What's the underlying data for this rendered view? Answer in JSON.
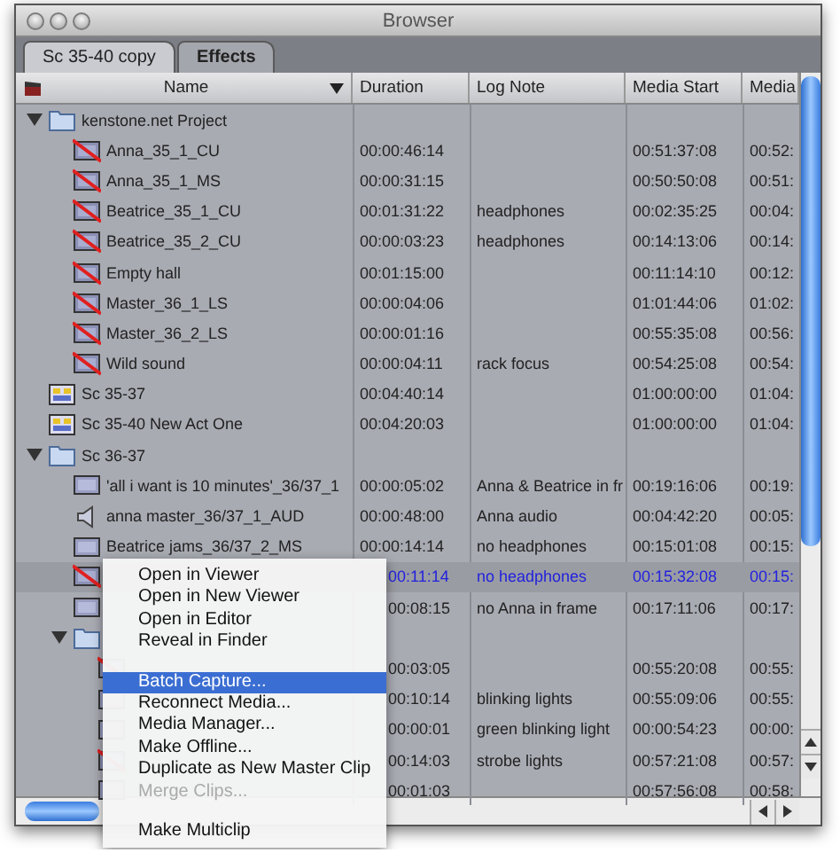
{
  "window": {
    "title": "Browser"
  },
  "tabs": [
    {
      "label": "Sc 35-40 copy",
      "selected": true
    },
    {
      "label": "Effects",
      "selected": false
    }
  ],
  "columns": [
    "Name",
    "Duration",
    "Log Note",
    "Media Start",
    "Media"
  ],
  "items": [
    {
      "kind": "folder",
      "name": "kenstone.net Project",
      "expanded": true,
      "selected": false,
      "children": [
        {
          "kind": "offline",
          "name": "Anna_35_1_CU",
          "duration": "00:00:46:14",
          "media_start": "00:51:37:08",
          "media_end": "00:52:",
          "selected": false
        },
        {
          "kind": "offline",
          "name": "Anna_35_1_MS",
          "duration": "00:00:31:15",
          "media_start": "00:50:50:08",
          "media_end": "00:51:",
          "selected": false
        },
        {
          "kind": "offline",
          "name": "Beatrice_35_1_CU",
          "duration": "00:01:31:22",
          "log_note": "headphones",
          "media_start": "00:02:35:25",
          "media_end": "00:04:",
          "selected": false
        },
        {
          "kind": "offline",
          "name": "Beatrice_35_2_CU",
          "duration": "00:00:03:23",
          "log_note": "headphones",
          "media_start": "00:14:13:06",
          "media_end": "00:14:",
          "selected": false
        },
        {
          "kind": "offline",
          "name": "Empty hall",
          "duration": "00:01:15:00",
          "media_start": "00:11:14:10",
          "media_end": "00:12:",
          "selected": false
        },
        {
          "kind": "offline",
          "name": "Master_36_1_LS",
          "duration": "00:00:04:06",
          "media_start": "01:01:44:06",
          "media_end": "01:02:",
          "selected": false
        },
        {
          "kind": "offline",
          "name": "Master_36_2_LS",
          "duration": "00:00:01:16",
          "media_start": "00:55:35:08",
          "media_end": "00:56:",
          "selected": false
        },
        {
          "kind": "offline",
          "name": "Wild sound",
          "duration": "00:00:04:11",
          "log_note": "rack focus",
          "media_start": "00:54:25:08",
          "media_end": "00:54:",
          "selected": false
        }
      ]
    },
    {
      "kind": "sequence",
      "name": "Sc 35-37",
      "duration": "00:04:40:14",
      "media_start": "01:00:00:00",
      "media_end": "01:04:",
      "selected": false
    },
    {
      "kind": "sequence",
      "name": "Sc 35-40 New Act One",
      "duration": "00:04:20:03",
      "media_start": "01:00:00:00",
      "media_end": "01:04:",
      "selected": false
    },
    {
      "kind": "folder",
      "name": "Sc 36-37",
      "expanded": true,
      "selected": false,
      "children": [
        {
          "kind": "clip",
          "name": "'all i want is 10 minutes'_36/37_1",
          "duration": "00:00:05:02",
          "log_note": "Anna & Beatrice in fr",
          "media_start": "00:19:16:06",
          "media_end": "00:19:",
          "selected": false
        },
        {
          "kind": "audio",
          "name": "anna master_36/37_1_AUD",
          "duration": "00:00:48:00",
          "log_note": "Anna audio",
          "media_start": "00:04:42:20",
          "media_end": "00:05:",
          "selected": false
        },
        {
          "kind": "clip",
          "name": "Beatrice jams_36/37_2_MS",
          "duration": "00:00:14:14",
          "log_note": "no headphones",
          "media_start": "00:15:01:08",
          "media_end": "00:15:",
          "selected": false
        },
        {
          "kind": "offline",
          "duration": "00:11:14",
          "log_note": "no headphones",
          "media_start": "00:15:32:08",
          "media_end": "00:15:",
          "selected": true
        },
        {
          "kind": "clip",
          "duration": "00:08:15",
          "log_note": "no Anna in frame",
          "media_start": "00:17:11:06",
          "media_end": "00:17:",
          "selected": false
        },
        {
          "kind": "folder",
          "expanded": true,
          "selected": false,
          "children": [
            {
              "kind": "offline",
              "duration": "00:03:05",
              "media_start": "00:55:20:08",
              "media_end": "00:55:",
              "selected": false
            },
            {
              "kind": "clip",
              "duration": "00:10:14",
              "log_note": "blinking lights",
              "media_start": "00:55:09:06",
              "media_end": "00:55:",
              "selected": false
            },
            {
              "kind": "clip",
              "duration": "00:00:01",
              "log_note": "green blinking light",
              "media_start": "00:00:54:23",
              "media_end": "00:00:",
              "selected": false
            },
            {
              "kind": "offline",
              "duration": "00:14:03",
              "log_note": "strobe lights",
              "media_start": "00:57:21:08",
              "media_end": "00:57:",
              "selected": false
            },
            {
              "kind": "clip",
              "duration": "00:01:03",
              "media_start": "00:57:56:08",
              "media_end": "00:58:",
              "selected": false
            }
          ]
        }
      ]
    }
  ],
  "context_menu": [
    {
      "kind": "item",
      "label": "Open in Viewer",
      "highlighted": false,
      "disabled": false
    },
    {
      "kind": "item",
      "label": "Open in New Viewer",
      "highlighted": false,
      "disabled": false
    },
    {
      "kind": "item",
      "label": "Open in Editor",
      "highlighted": false,
      "disabled": false
    },
    {
      "kind": "item",
      "label": "Reveal in Finder",
      "highlighted": false,
      "disabled": false
    },
    {
      "kind": "separator"
    },
    {
      "kind": "item",
      "label": "Batch Capture...",
      "highlighted": true,
      "disabled": false
    },
    {
      "kind": "item",
      "label": "Reconnect Media...",
      "highlighted": false,
      "disabled": false
    },
    {
      "kind": "item",
      "label": "Media Manager...",
      "highlighted": false,
      "disabled": false
    },
    {
      "kind": "item",
      "label": "Make Offline...",
      "highlighted": false,
      "disabled": false
    },
    {
      "kind": "item",
      "label": "Duplicate as New Master Clip",
      "highlighted": false,
      "disabled": false
    },
    {
      "kind": "item",
      "label": "Merge Clips...",
      "highlighted": false,
      "disabled": true
    },
    {
      "kind": "separator"
    },
    {
      "kind": "item",
      "label": "Make Multiclip",
      "highlighted": false,
      "disabled": false
    }
  ]
}
